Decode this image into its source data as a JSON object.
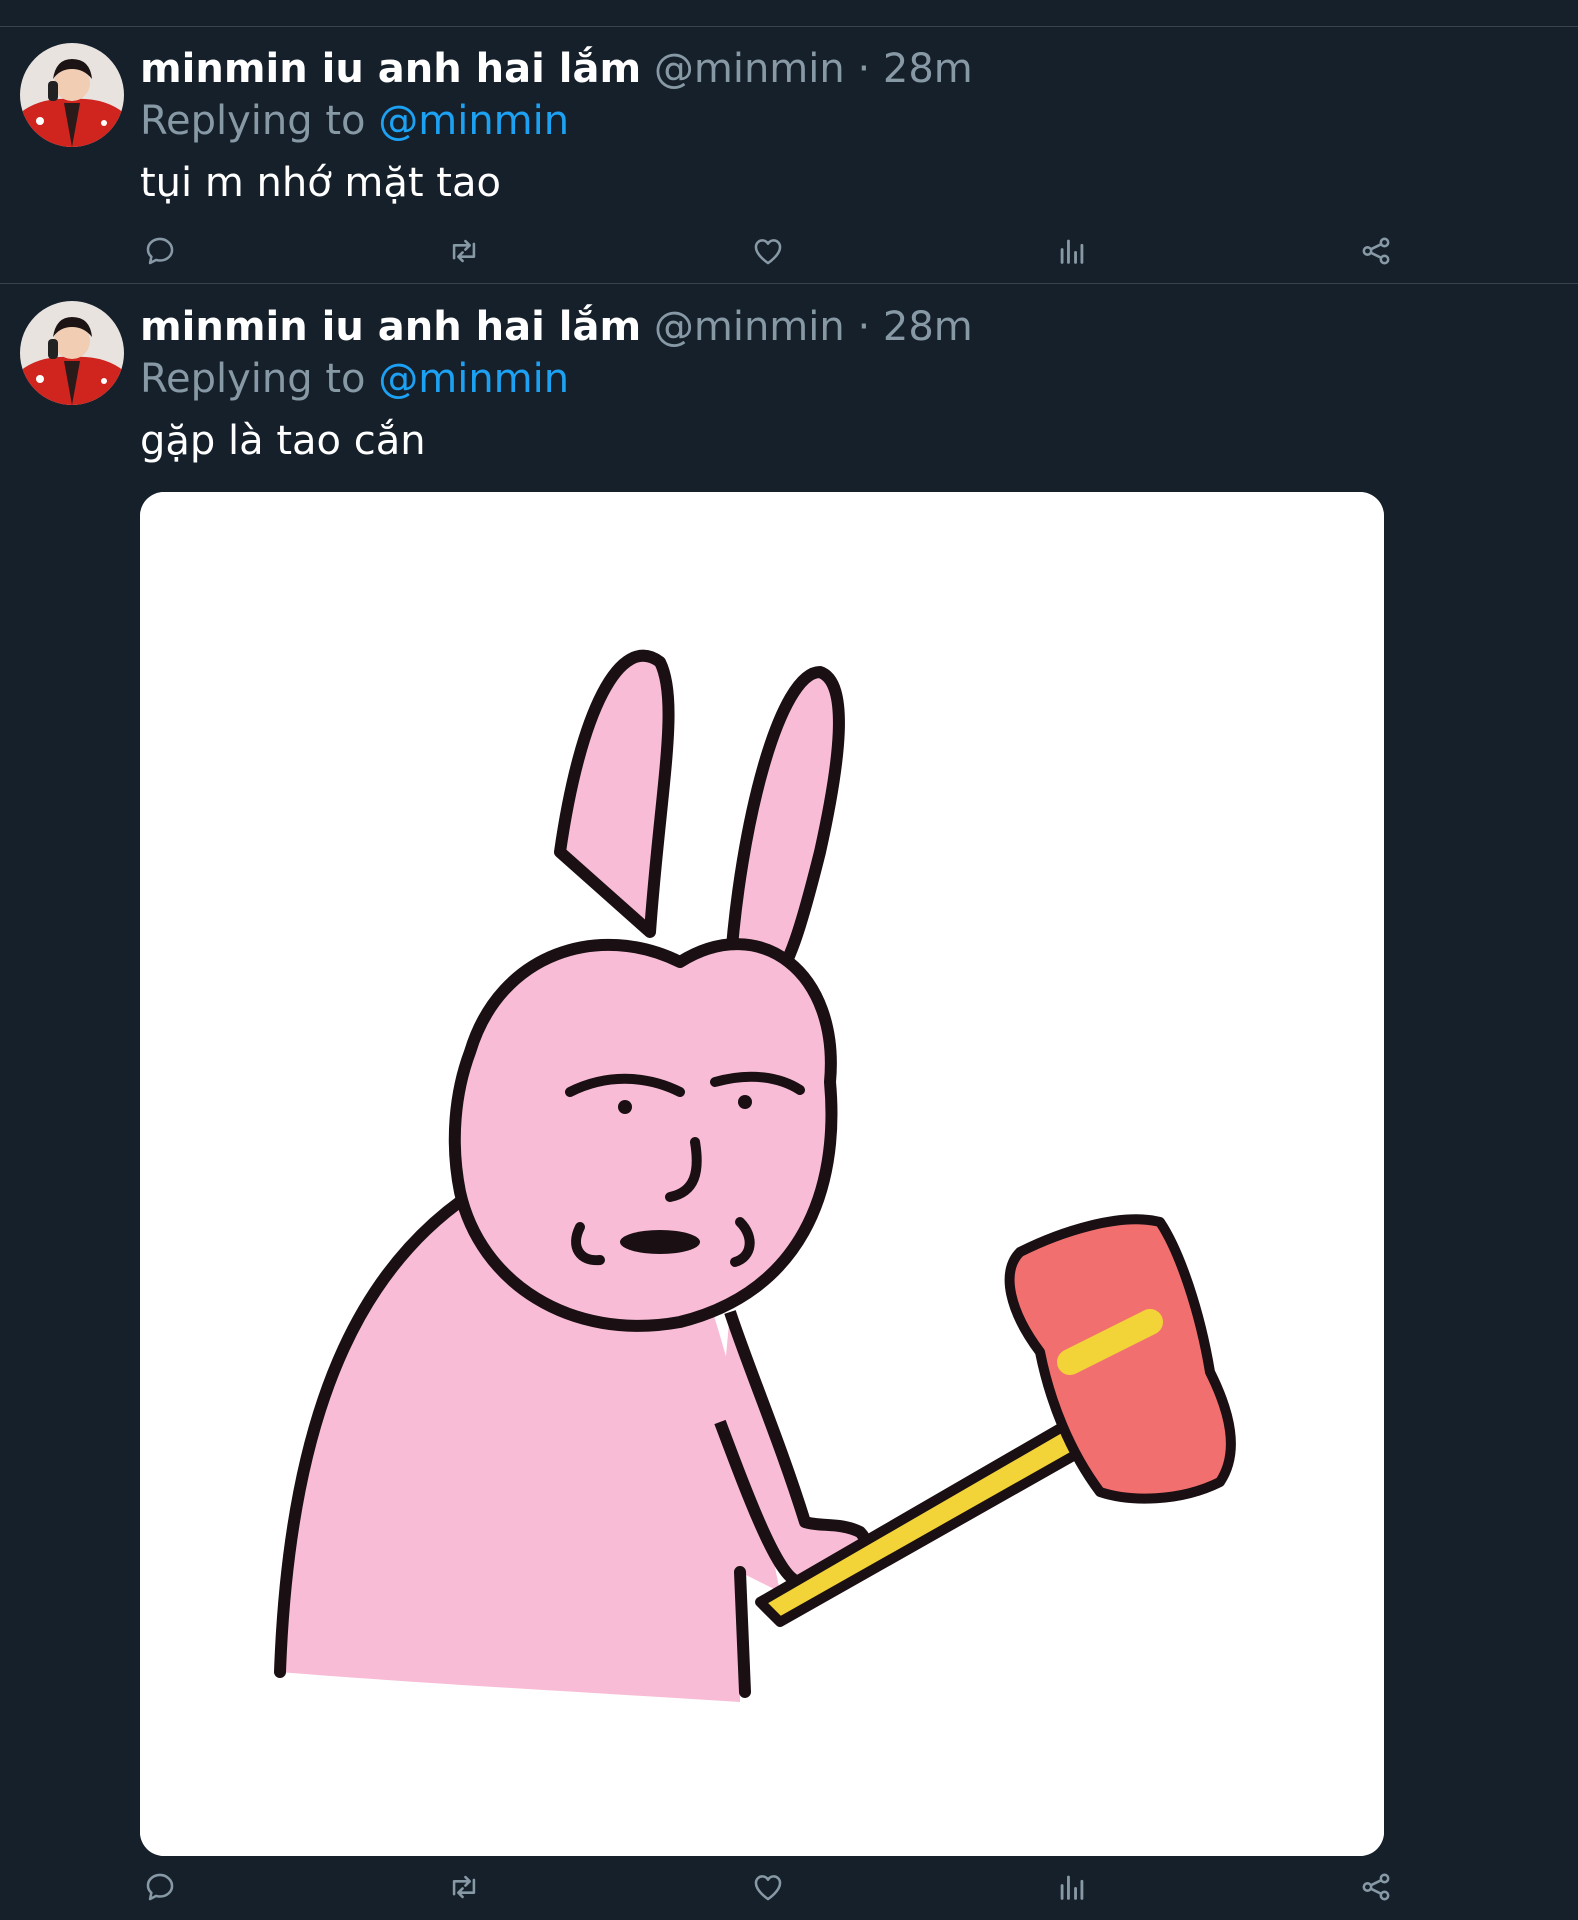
{
  "colors": {
    "background": "#15202b",
    "divider": "#38444d",
    "muted_text": "#8899a6",
    "link": "#1da1f2",
    "primary_text": "#ffffff"
  },
  "icons": {
    "reply": "reply-icon",
    "retweet": "retweet-icon",
    "like": "heart-icon",
    "analytics": "analytics-icon",
    "share": "share-icon"
  },
  "tweets": [
    {
      "display_name": "minmin iu anh hai lắm",
      "handle": "@minmin",
      "separator": "·",
      "time": "28m",
      "reply_prefix": "Replying to",
      "reply_to": "@minmin",
      "text": "tụi m nhớ mặt tao"
    },
    {
      "display_name": "minmin iu anh hai lắm",
      "handle": "@minmin",
      "separator": "·",
      "time": "28m",
      "reply_prefix": "Replying to",
      "reply_to": "@minmin",
      "text": "gặp là tao cắn",
      "media": "pink-rabbit-with-hammer-image"
    }
  ]
}
